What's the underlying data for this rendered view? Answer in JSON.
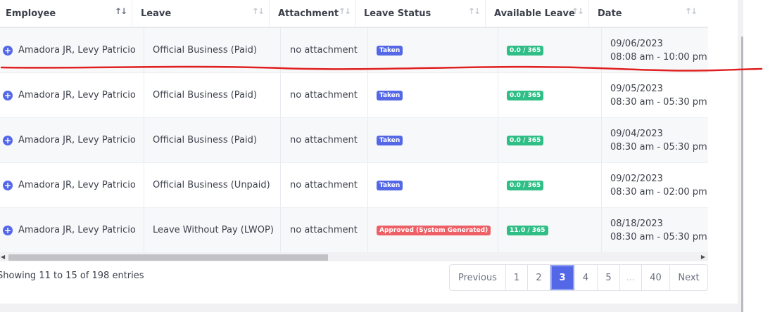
{
  "table": {
    "columns": [
      {
        "label": "Employee",
        "sort_icon": "sort-active-icon"
      },
      {
        "label": "Leave",
        "sort_icon": "sort-icon"
      },
      {
        "label": "Attachment",
        "sort_icon": "sort-icon"
      },
      {
        "label": "Leave Status",
        "sort_icon": "sort-icon"
      },
      {
        "label": "Available Leave",
        "sort_icon": "sort-icon"
      },
      {
        "label": "Date",
        "sort_icon": "sort-icon"
      }
    ],
    "rows": [
      {
        "employee": "Amadora JR, Levy Patricio",
        "leave": "Official Business (Paid)",
        "attachment": "no attachment",
        "status": "Taken",
        "status_color": "#5468e7",
        "available": "0.0 / 365",
        "date": "09/06/2023",
        "time": "08:08 am - 10:00 pm"
      },
      {
        "employee": "Amadora JR, Levy Patricio",
        "leave": "Official Business (Paid)",
        "attachment": "no attachment",
        "status": "Taken",
        "status_color": "#5468e7",
        "available": "0.0 / 365",
        "date": "09/05/2023",
        "time": "08:30 am - 05:30 pm"
      },
      {
        "employee": "Amadora JR, Levy Patricio",
        "leave": "Official Business (Paid)",
        "attachment": "no attachment",
        "status": "Taken",
        "status_color": "#5468e7",
        "available": "0.0 / 365",
        "date": "09/04/2023",
        "time": "08:30 am - 05:30 pm"
      },
      {
        "employee": "Amadora JR, Levy Patricio",
        "leave": "Official Business (Unpaid)",
        "attachment": "no attachment",
        "status": "Taken",
        "status_color": "#5468e7",
        "available": "0.0 / 365",
        "date": "09/02/2023",
        "time": "08:30 am - 02:00 pm"
      },
      {
        "employee": "Amadora JR, Levy Patricio",
        "leave": "Leave Without Pay (LWOP)",
        "attachment": "no attachment",
        "status": "Approved (System Generated)",
        "status_color": "#ee5f66",
        "available": "11.0 / 365",
        "date": "08/18/2023",
        "time": "08:30 am - 05:30 pm"
      }
    ]
  },
  "info": "Showing 11 to 15 of 198 entries",
  "pagination": {
    "previous": "Previous",
    "pages": [
      "1",
      "2",
      "3",
      "4",
      "5",
      "...",
      "40"
    ],
    "active": "3",
    "next": "Next"
  },
  "colors": {
    "accent": "#5468e7",
    "success": "#2fbf86",
    "danger": "#ee5f66",
    "annotation": "#e02020"
  }
}
